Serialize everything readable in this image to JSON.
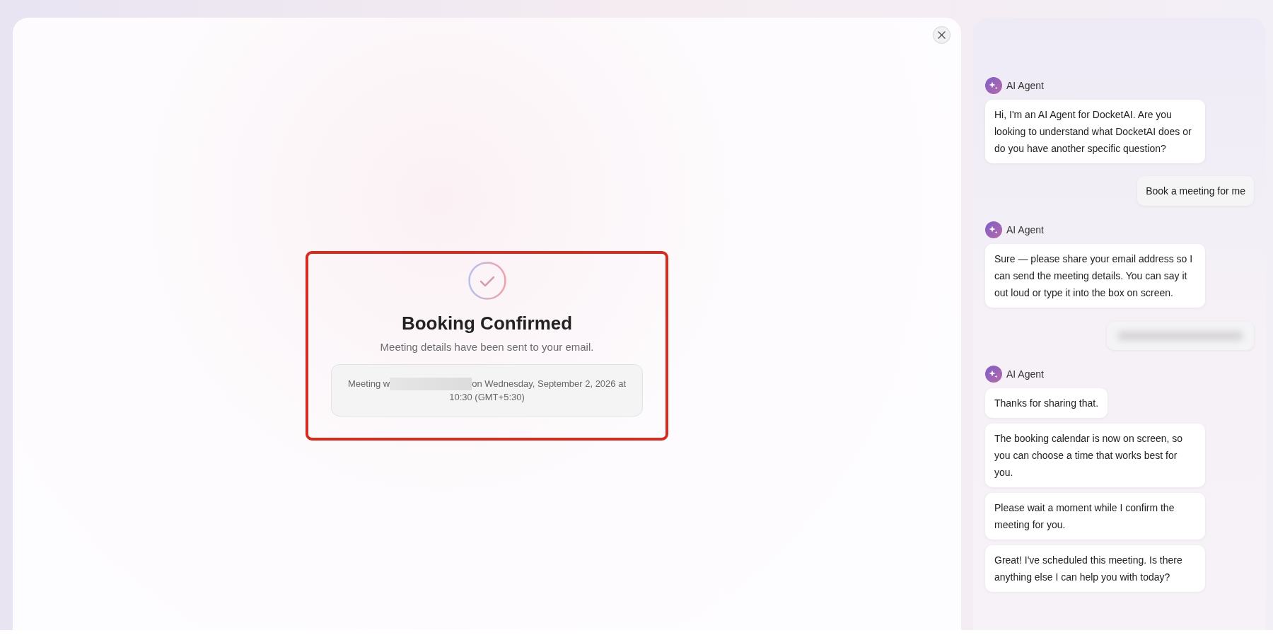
{
  "confirmation": {
    "title": "Booking Confirmed",
    "subtitle": "Meeting details have been sent to your email.",
    "details_before": "Meeting w",
    "details_after": "on Wednesday, September 2, 2026 at 10:30 (GMT+5:30)"
  },
  "chat": {
    "messages": [
      {
        "kind": "agent_label",
        "text": "AI Agent"
      },
      {
        "kind": "agent",
        "text": "Hi, I'm an AI Agent for DocketAI. Are you looking to understand what DocketAI does or do you have another specific question?"
      },
      {
        "kind": "user",
        "text": "Book a meeting for me"
      },
      {
        "kind": "agent_label",
        "text": "AI Agent"
      },
      {
        "kind": "agent",
        "text": "Sure — please share your email address so I can send the meeting details. You can say it out loud or type it into the box on screen."
      },
      {
        "kind": "redacted"
      },
      {
        "kind": "agent_label",
        "text": "AI Agent"
      },
      {
        "kind": "agent",
        "text": "Thanks for sharing that."
      },
      {
        "kind": "agent",
        "text": "The booking calendar is now on screen, so you can choose a time that works best for you."
      },
      {
        "kind": "agent",
        "text": "Please wait a moment while I confirm the meeting for you."
      },
      {
        "kind": "agent",
        "text": "Great! I've scheduled this meeting. Is there anything else I can help you with today?"
      }
    ]
  }
}
